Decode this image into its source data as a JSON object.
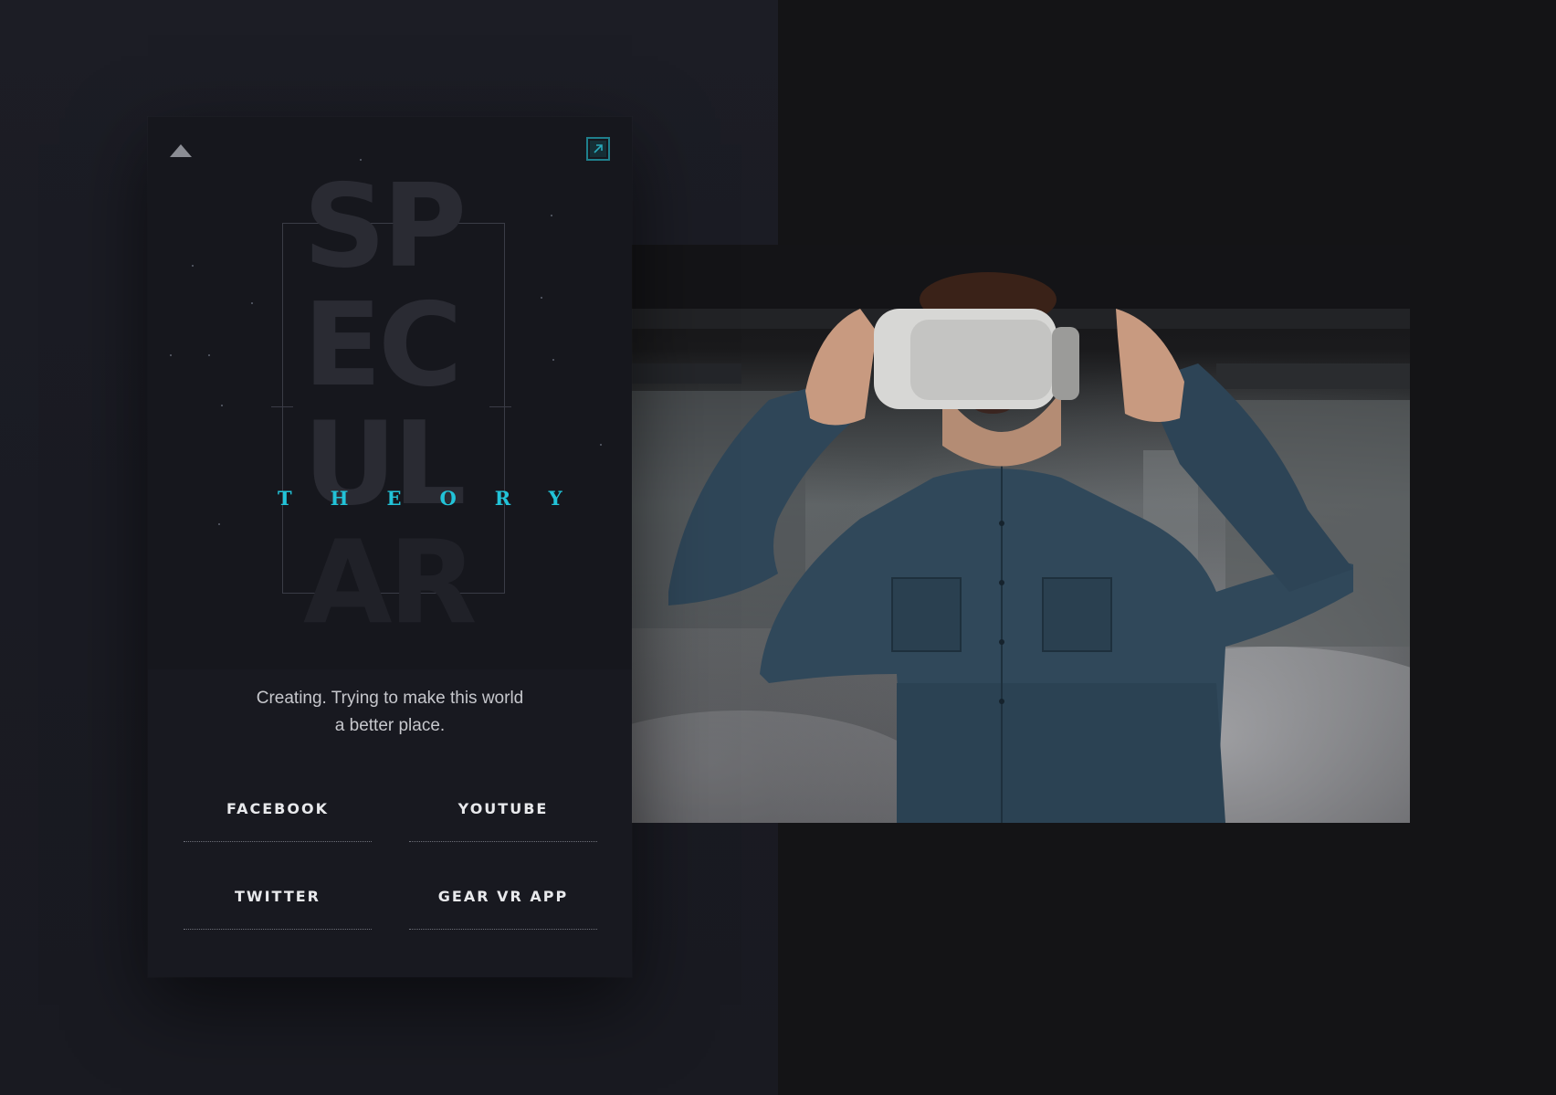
{
  "brand": {
    "word_rows": [
      "SP",
      "EC",
      "UL",
      "AR"
    ],
    "subtitle": "THEORY"
  },
  "tagline": {
    "line1": "Creating. Trying to make this world",
    "line2": "a better place."
  },
  "links": {
    "facebook": "FACEBOOK",
    "youtube": "YOUTUBE",
    "twitter": "TWITTER",
    "gear_vr": "GEAR VR APP"
  },
  "icons": {
    "top_left": "triangle-up-icon",
    "top_right": "expand-icon"
  },
  "colors": {
    "accent": "#22c3d8",
    "card_bg": "#181920",
    "page_bg": "#1a1b23"
  }
}
